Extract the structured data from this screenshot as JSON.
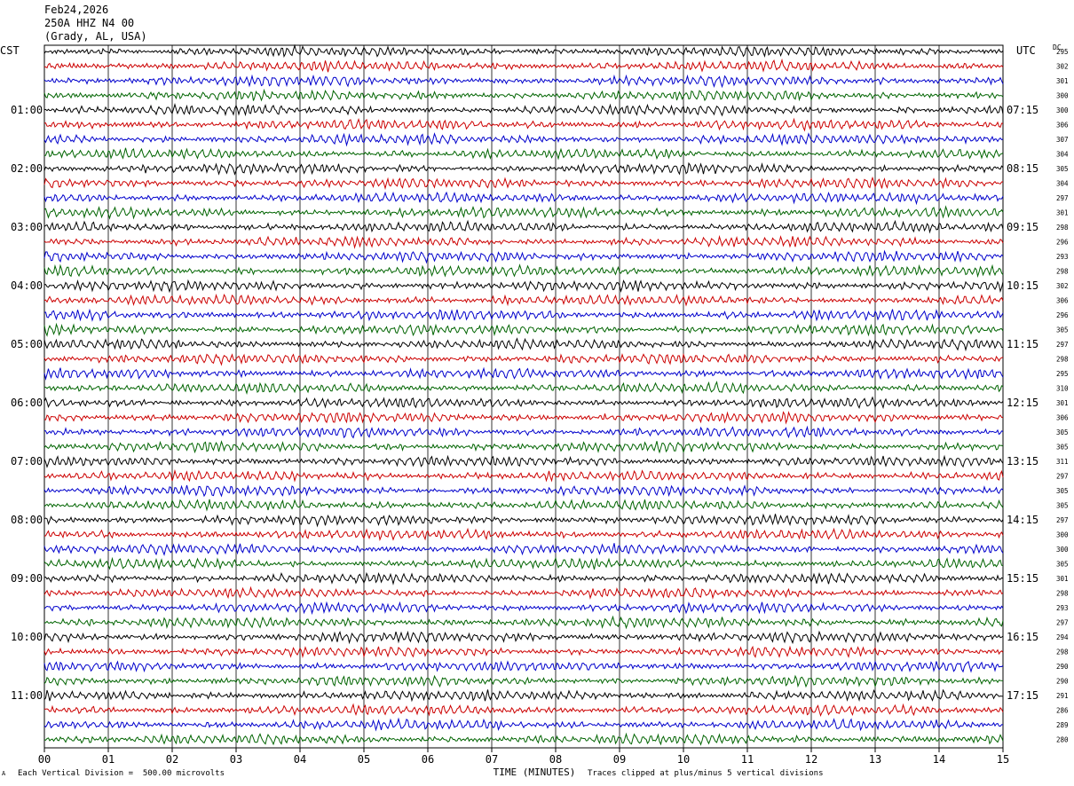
{
  "header": {
    "date": "Feb24,2026",
    "station": "250A HHZ N4 00",
    "location": "(Grady, AL, USA)"
  },
  "corner_labels": {
    "left_tz": "CST",
    "right_tz": "UTC",
    "dc_label": "DC"
  },
  "footer": {
    "scale_note": "Each Vertical Division =  500.00 microvolts",
    "clip_note": "Traces clipped at plus/minus 5 vertical divisions",
    "corner_mark": "A"
  },
  "chart_data": {
    "type": "line",
    "title": "",
    "xlabel": "TIME (MINUTES)",
    "x_ticks": [
      "00",
      "01",
      "02",
      "03",
      "04",
      "05",
      "06",
      "07",
      "08",
      "09",
      "10",
      "11",
      "12",
      "13",
      "14",
      "15"
    ],
    "xlim": [
      0,
      15
    ],
    "left_hour_labels": [
      "01:00",
      "02:00",
      "03:00",
      "04:00",
      "05:00",
      "06:00",
      "07:00",
      "08:00",
      "09:00",
      "10:00",
      "11:00"
    ],
    "right_hour_labels": [
      "07:15",
      "08:15",
      "09:15",
      "10:15",
      "11:15",
      "12:15",
      "13:15",
      "14:15",
      "15:15",
      "16:15",
      "17:15"
    ],
    "trace_colors": [
      "#000000",
      "#cc0000",
      "#0000cc",
      "#006400"
    ],
    "dc_offsets": [
      295,
      302,
      301,
      300,
      300,
      306,
      307,
      304,
      305,
      304,
      297,
      301,
      298,
      296,
      293,
      298,
      302,
      306,
      296,
      305,
      297,
      298,
      295,
      310,
      301,
      306,
      305,
      305,
      311,
      297,
      305,
      305,
      297,
      300,
      300,
      305,
      301,
      298,
      293,
      297,
      294,
      298,
      290,
      290,
      291,
      286,
      289,
      280
    ],
    "traces_per_hour": 4,
    "vertical_division_microvolts": 500.0,
    "clip_divisions": 5
  }
}
